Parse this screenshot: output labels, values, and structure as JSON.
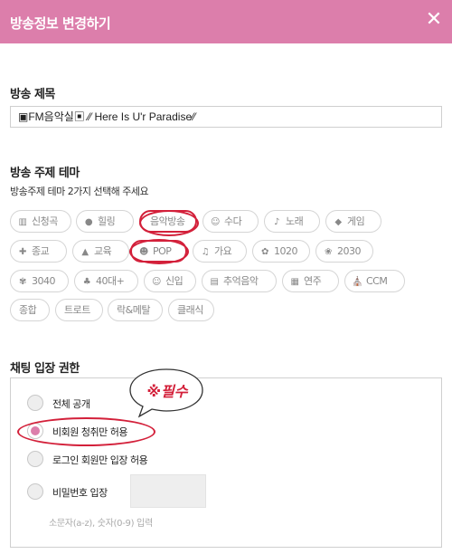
{
  "header": {
    "title": "방송정보 변경하기",
    "close_icon": "close-icon"
  },
  "broadcast_title": {
    "label": "방송 제목",
    "value": "▣FM음악실▣ ⁄⁄ Here Is U'r Paradise⁄⁄"
  },
  "theme": {
    "label": "방송 주제 테마",
    "instruction": "방송주제 테마 2가지 선택해 주세요",
    "chips": [
      {
        "label": "신청곡",
        "icon": "▥",
        "icon_name": "note-icon",
        "selected": false
      },
      {
        "label": "힐링",
        "icon": "●",
        "icon_name": "cup-icon",
        "selected": false
      },
      {
        "label": "음악방송",
        "icon": "",
        "icon_name": "",
        "selected": true
      },
      {
        "label": "수다",
        "icon": "☺",
        "icon_name": "face-icon",
        "selected": false
      },
      {
        "label": "노래",
        "icon": "♪",
        "icon_name": "microphone-icon",
        "selected": false
      },
      {
        "label": "게임",
        "icon": "◆",
        "icon_name": "gamepad-icon",
        "selected": false
      },
      {
        "label": "종교",
        "icon": "✚",
        "icon_name": "prayer-icon",
        "selected": false
      },
      {
        "label": "교육",
        "icon": "▲",
        "icon_name": "graduation-cap-icon",
        "selected": false
      },
      {
        "label": "POP",
        "icon": "☻",
        "icon_name": "rocker-icon",
        "selected": true
      },
      {
        "label": "가요",
        "icon": "♫",
        "icon_name": "music-notes-icon",
        "selected": false
      },
      {
        "label": "1020",
        "icon": "✿",
        "icon_name": "sprout-icon",
        "selected": false
      },
      {
        "label": "2030",
        "icon": "❀",
        "icon_name": "rose-icon",
        "selected": false
      },
      {
        "label": "3040",
        "icon": "✾",
        "icon_name": "tulip-icon",
        "selected": false
      },
      {
        "label": "40대+",
        "icon": "♣",
        "icon_name": "tree-icon",
        "selected": false
      },
      {
        "label": "신입",
        "icon": "☺",
        "icon_name": "baby-icon",
        "selected": false
      },
      {
        "label": "추억음악",
        "icon": "▤",
        "icon_name": "radio-icon",
        "selected": false
      },
      {
        "label": "연주",
        "icon": "▦",
        "icon_name": "piano-icon",
        "selected": false
      },
      {
        "label": "CCM",
        "icon": "⛪",
        "icon_name": "church-icon",
        "selected": false
      },
      {
        "label": "종합",
        "icon": "",
        "icon_name": "",
        "selected": false
      },
      {
        "label": "트로트",
        "icon": "",
        "icon_name": "",
        "selected": false
      },
      {
        "label": "락&메탈",
        "icon": "",
        "icon_name": "",
        "selected": false
      },
      {
        "label": "클래식",
        "icon": "",
        "icon_name": "",
        "selected": false
      }
    ]
  },
  "chat_permission": {
    "label": "채팅 입장 권한",
    "options": [
      {
        "label": "전체 공개",
        "checked": false
      },
      {
        "label": "비회원 청취만 허용",
        "checked": true
      },
      {
        "label": "로그인 회원만 입장 허용",
        "checked": false
      },
      {
        "label": "비밀번호 입장",
        "checked": false
      }
    ],
    "password_hint": "소문자(a-z), 숫자(0-9) 입력"
  },
  "annotation": {
    "required_note": "※필수"
  },
  "colors": {
    "header_bg": "#dc7eab",
    "annotation_red": "#d3203a",
    "radio_checked": "#dc7eab"
  }
}
